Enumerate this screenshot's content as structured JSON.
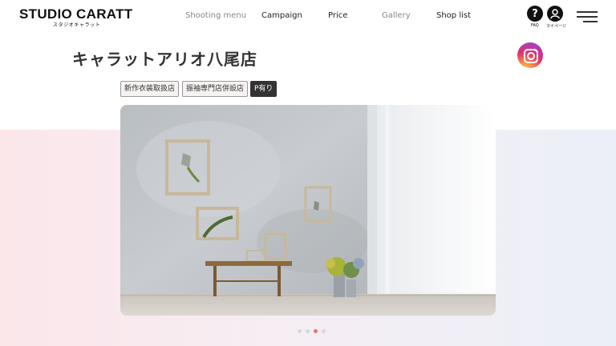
{
  "header": {
    "logo": "STUDIO CARATT",
    "logo_sub": "スタジオキャラット",
    "nav": [
      "Shooting menu",
      "Campaign",
      "Price",
      "Gallery",
      "Shop list"
    ],
    "faq_label": "FAQ",
    "mypage_label": "マイページ"
  },
  "store": {
    "name": "キャラットアリオ八尾店",
    "tags": [
      "新作衣装取扱店",
      "振袖専門店併設店",
      "P有り"
    ]
  },
  "carousel": {
    "slide_count": 4,
    "active_index": 2
  },
  "colors": {
    "accent_dot": "#e8776a",
    "tag_dark": "#333333"
  }
}
